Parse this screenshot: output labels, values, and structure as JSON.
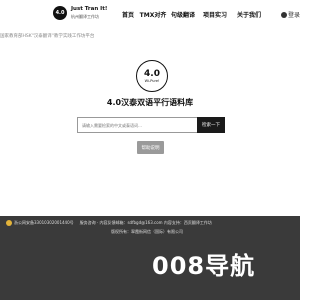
{
  "header": {
    "logo_badge": "4.0",
    "logo_title": "Just Tran It!",
    "logo_sub": "杭州翻译工作坊",
    "nav": [
      "首页",
      "TMX对齐",
      "句级翻译",
      "项目实习",
      "关于我们"
    ],
    "login": "登录"
  },
  "announce": "国家教育部HSK\"汉泰翻译\"教学实践工作坊平台",
  "center_logo": {
    "big": "4.0",
    "small": "Wi-Pure!"
  },
  "main_title": "4.0汉泰双语平行语料库",
  "search": {
    "placeholder": "请输入需要检索的中文或泰语词…",
    "button": "检索一下"
  },
  "help_button": "帮助说明",
  "footer": {
    "icp": "浙公网安备33010302001440号",
    "contact": "服务咨询 · 内容反馈邮箱：sdfbgd@163.com 内容支持：西贡翻译工作坊",
    "copyright": "版权所有：翠霞街网信（国际）有限公司"
  },
  "brand": "008导航"
}
